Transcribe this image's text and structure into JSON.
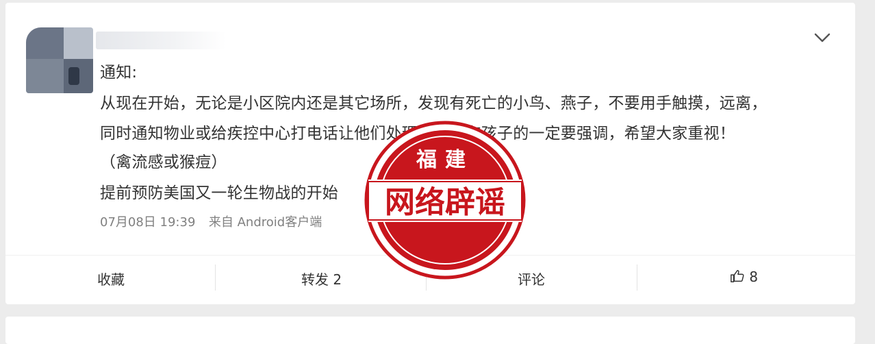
{
  "post": {
    "lines": [
      "通知:",
      "从现在开始，无论是小区院内还是其它场所，发现有死亡的小鸟、燕子，不要用手触摸，远离，",
      "同时通知物业或给疾控中心打电话让他们处理。家里有孩子的一定要强调，希望大家重视！",
      "（禽流感或猴痘）",
      "提前预防美国又一轮生物战的开始"
    ],
    "date": "07月08日 19:39",
    "source": "来自 Android客户端"
  },
  "actions": {
    "favorite": "收藏",
    "repost": "转发 2",
    "comment": "评论",
    "like_count": "8"
  },
  "stamp": {
    "top_text": "福建",
    "main_text": "网络辟谣",
    "color": "#c8161d"
  },
  "icons": {
    "menu": "chevron-down-icon",
    "like": "thumbs-up-icon"
  }
}
